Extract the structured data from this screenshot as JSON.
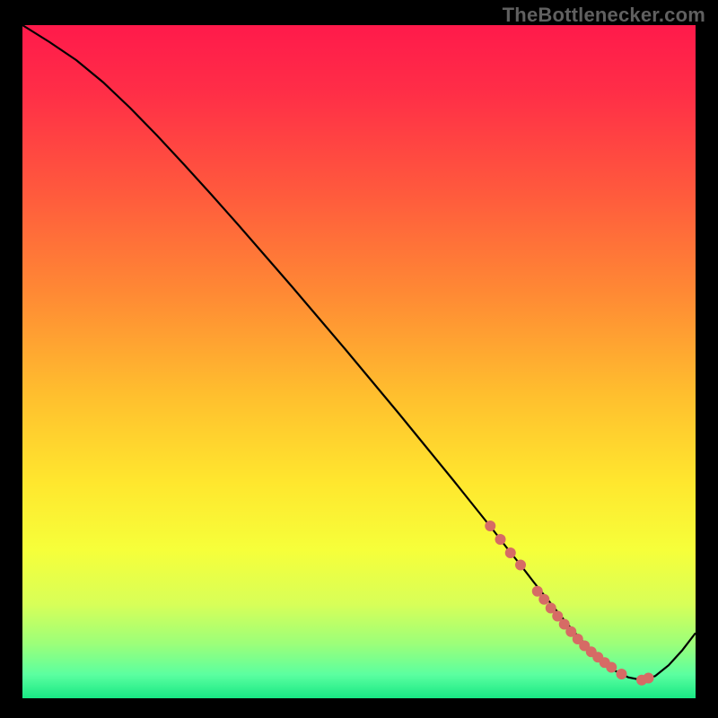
{
  "attribution": "TheBottlenecker.com",
  "colors": {
    "page_bg": "#000000",
    "text": "#606060",
    "curve_stroke": "#000000",
    "marker_fill": "#d66b65",
    "gradient_stops": [
      {
        "offset": 0.0,
        "color": "#ff1a4b"
      },
      {
        "offset": 0.1,
        "color": "#ff2e47"
      },
      {
        "offset": 0.25,
        "color": "#ff5a3d"
      },
      {
        "offset": 0.4,
        "color": "#ff8a34"
      },
      {
        "offset": 0.55,
        "color": "#ffbf2e"
      },
      {
        "offset": 0.68,
        "color": "#ffe72e"
      },
      {
        "offset": 0.78,
        "color": "#f6ff3a"
      },
      {
        "offset": 0.86,
        "color": "#d8ff58"
      },
      {
        "offset": 0.92,
        "color": "#9bff7a"
      },
      {
        "offset": 0.965,
        "color": "#5bffa0"
      },
      {
        "offset": 1.0,
        "color": "#18e884"
      }
    ]
  },
  "chart_data": {
    "type": "line",
    "title": "",
    "xlabel": "",
    "ylabel": "",
    "xlim": [
      0,
      100
    ],
    "ylim": [
      0,
      100
    ],
    "grid": false,
    "legend": false,
    "series": [
      {
        "name": "bottleneck-curve",
        "x": [
          0,
          4,
          8,
          12,
          16,
          20,
          24,
          28,
          32,
          36,
          40,
          44,
          48,
          52,
          56,
          60,
          64,
          68,
          70,
          72,
          74,
          76,
          78,
          80,
          82,
          84,
          86,
          88,
          90,
          92,
          94,
          96,
          98,
          100
        ],
        "y": [
          100,
          97.5,
          94.8,
          91.5,
          87.7,
          83.6,
          79.3,
          74.9,
          70.4,
          65.8,
          61.2,
          56.5,
          51.8,
          47.0,
          42.2,
          37.3,
          32.4,
          27.4,
          24.9,
          22.3,
          19.8,
          17.2,
          14.7,
          12.2,
          9.8,
          7.6,
          5.7,
          4.1,
          3.1,
          2.7,
          3.3,
          4.9,
          7.1,
          9.7
        ]
      }
    ],
    "markers": {
      "name": "highlight-points",
      "x": [
        69.5,
        71.0,
        72.5,
        74.0,
        76.5,
        77.5,
        78.5,
        79.5,
        80.5,
        81.5,
        82.5,
        83.5,
        84.5,
        85.5,
        86.5,
        87.5,
        89.0,
        92.0,
        93.0
      ],
      "y": [
        25.6,
        23.6,
        21.6,
        19.8,
        15.9,
        14.7,
        13.4,
        12.2,
        11.0,
        9.9,
        8.8,
        7.8,
        6.9,
        6.1,
        5.3,
        4.6,
        3.6,
        2.7,
        3.0
      ]
    }
  }
}
